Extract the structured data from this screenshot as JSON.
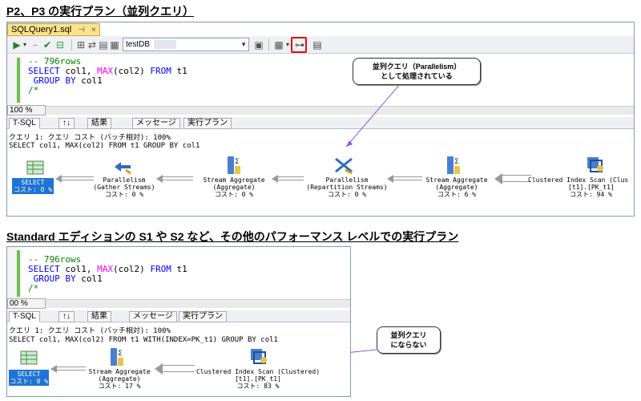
{
  "headings": {
    "top": "P2、P3 の実行プラン（並列クエリ）",
    "bottom": "Standard エディションの S1 や S2 など、その他のパフォーマンス レベルでの実行プラン"
  },
  "panel1": {
    "document_tab": "SQLQuery1.sql",
    "database": "testDB",
    "code_lines": [
      "-- 796rows",
      "SELECT col1, MAX(col2) FROM t1",
      " GROUP BY col1",
      "/*"
    ],
    "zoom": "100 %",
    "result_tabs": [
      "T-SQL",
      "↑↓",
      "結果",
      "メッセージ",
      "実行プラン"
    ],
    "query_header": "クエリ 1: クエリ コスト (バッチ相対): 100%",
    "query_text": "SELECT col1, MAX(col2) FROM t1 GROUP BY col1",
    "nodes": [
      {
        "name": "SELECT",
        "cost": "コスト: 0 %"
      },
      {
        "name": "Parallelism",
        "sub": "(Gather Streams)",
        "cost": "コスト: 0 %"
      },
      {
        "name": "Stream Aggregate",
        "sub": "(Aggregate)",
        "cost": "コスト: 0 %"
      },
      {
        "name": "Parallelism",
        "sub": "(Repartition Streams)",
        "cost": "コスト: 0 %"
      },
      {
        "name": "Stream Aggregate",
        "sub": "(Aggregate)",
        "cost": "コスト: 6 %"
      },
      {
        "name": "Clustered Index Scan (Clus",
        "sub": "[t1].[PK_t1]",
        "cost": "コスト: 94 %"
      }
    ],
    "callout": [
      "並列クエリ（Parallelism）",
      "として処理されている"
    ]
  },
  "panel2": {
    "code_lines": [
      "-- 796rows",
      "SELECT col1, MAX(col2) FROM t1",
      " GROUP BY col1",
      "/*"
    ],
    "zoom": "00 %",
    "result_tabs": [
      "T-SQL",
      "↑↓",
      "結果",
      "メッセージ",
      "実行プラン"
    ],
    "query_header": "クエリ 1: クエリ コスト (バッチ相対): 100%",
    "query_text": "SELECT col1, MAX(col2) FROM t1 WITH(INDEX=PK_t1) GROUP BY col1",
    "nodes": [
      {
        "name": "SELECT",
        "cost": "コスト: 0 %"
      },
      {
        "name": "Stream Aggregate",
        "sub": "(Aggregate)",
        "cost": "コスト: 17 %"
      },
      {
        "name": "Clustered Index Scan (Clustered)",
        "sub": "[t1].[PK_t1]",
        "cost": "コスト: 83 %"
      }
    ],
    "callout": [
      "並列クエリ",
      "にならない"
    ]
  },
  "colors": {
    "select_highlight": "#1e73d6",
    "tab_yellow": "#fce28a",
    "red_box": "#e01010",
    "callout_line": "#8e5bd6"
  }
}
